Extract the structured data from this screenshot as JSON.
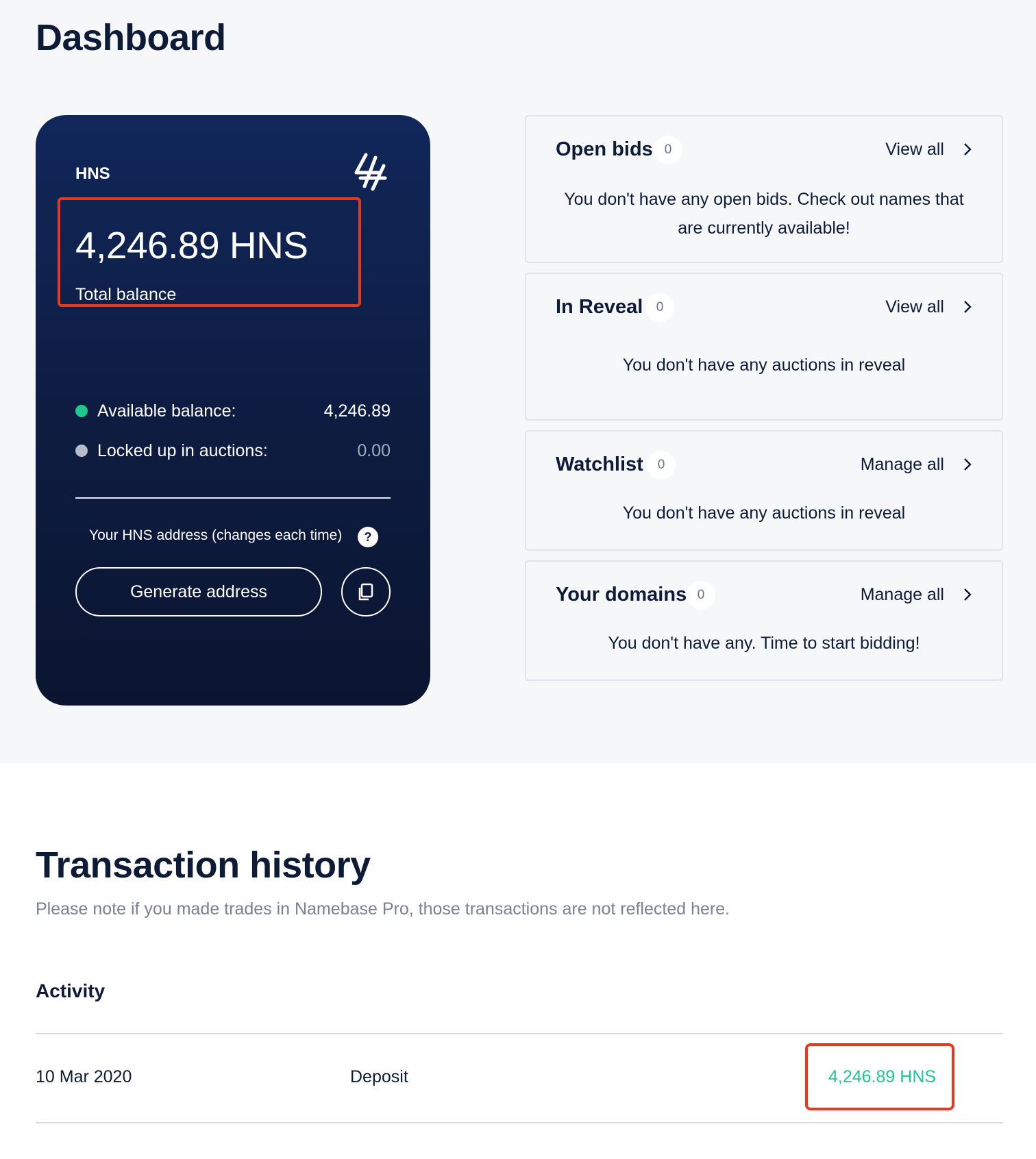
{
  "page": {
    "title": "Dashboard"
  },
  "colors": {
    "accent_green": "#1ec88c",
    "highlight_red": "#e8391c",
    "navy": "#0e1b36"
  },
  "balance_card": {
    "currency": "HNS",
    "logo_icon": "handshake-logo-icon",
    "total_balance": "4,246.89 HNS",
    "total_balance_label": "Total balance",
    "available_label": "Available balance:",
    "available_value": "4,246.89",
    "locked_label": "Locked up in auctions:",
    "locked_value": "0.00",
    "address_label": "Your HNS address (changes each time)",
    "help_icon": "?",
    "generate_button_label": "Generate address",
    "copy_icon": "copy-icon"
  },
  "panels": [
    {
      "title": "Open bids",
      "count": "0",
      "link_label": "View all",
      "message": "You don't have any open bids. Check out names that are currently available!"
    },
    {
      "title": "In Reveal",
      "count": "0",
      "link_label": "View all",
      "message": "You don't have any auctions in reveal"
    },
    {
      "title": "Watchlist",
      "count": "0",
      "link_label": "Manage all",
      "message": "You don't have any auctions in reveal"
    },
    {
      "title": "Your domains",
      "count": "0",
      "link_label": "Manage all",
      "message": "You don't have any. Time to start bidding!"
    }
  ],
  "transaction_history": {
    "title": "Transaction history",
    "note": "Please note if you made trades in Namebase Pro, those transactions are not reflected here.",
    "activity_label": "Activity",
    "rows": [
      {
        "date": "10 Mar 2020",
        "type": "Deposit",
        "amount": "4,246.89 HNS"
      }
    ]
  }
}
